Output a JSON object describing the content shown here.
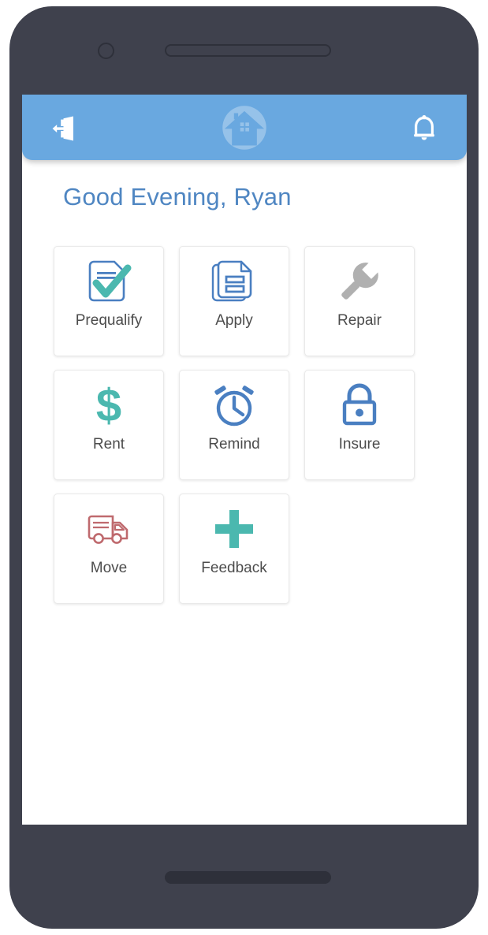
{
  "device": {
    "camera": "camera-lens",
    "speaker": "earpiece-speaker",
    "home_bar": "home-indicator"
  },
  "appbar": {
    "logout_label": "Logout",
    "logout_icon": "logout-door-icon",
    "logo_icon": "home-shield-logo",
    "notifications_label": "Notifications",
    "notifications_icon": "bell-icon",
    "background_color": "#69a8e0"
  },
  "greeting": {
    "text": "Good Evening, Ryan",
    "color": "#4f86c2"
  },
  "colors": {
    "blue": "#4a7fc1",
    "teal": "#4bb8af",
    "gray": "#b0b0b0",
    "red": "#bf6a6e",
    "label": "#4c4c4c"
  },
  "grid": {
    "tiles": [
      {
        "label": "Prequalify",
        "icon": "document-checkmark-icon",
        "color": "#4a7fc1"
      },
      {
        "label": "Apply",
        "icon": "document-form-icon",
        "color": "#4a7fc1"
      },
      {
        "label": "Repair",
        "icon": "wrench-icon",
        "color": "#b0b0b0"
      },
      {
        "label": "Rent",
        "icon": "dollar-sign-icon",
        "color": "#4bb8af"
      },
      {
        "label": "Remind",
        "icon": "alarm-clock-icon",
        "color": "#4a7fc1"
      },
      {
        "label": "Insure",
        "icon": "padlock-icon",
        "color": "#4a7fc1"
      },
      {
        "label": "Move",
        "icon": "moving-truck-icon",
        "color": "#bf6a6e"
      },
      {
        "label": "Feedback",
        "icon": "plus-icon",
        "color": "#4bb8af"
      }
    ]
  }
}
